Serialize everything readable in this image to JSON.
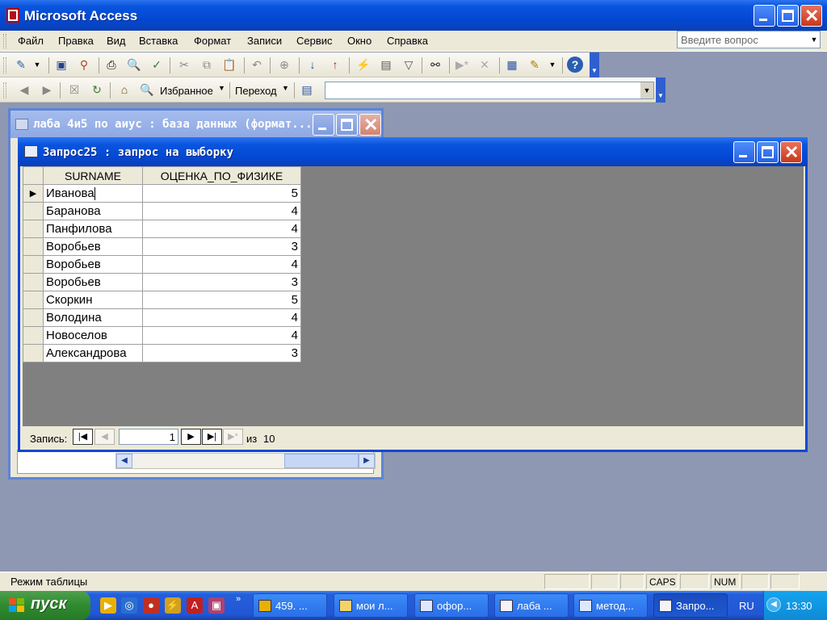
{
  "app": {
    "title": "Microsoft Access"
  },
  "menu": {
    "items": [
      "Файл",
      "Правка",
      "Вид",
      "Вставка",
      "Формат",
      "Записи",
      "Сервис",
      "Окно",
      "Справка"
    ],
    "help_placeholder": "Введите вопрос"
  },
  "web_toolbar": {
    "favorites": "Избранное",
    "go": "Переход"
  },
  "db_window": {
    "title": "лаба 4и5 по аиус : база данных (формат..."
  },
  "query_window": {
    "title": "Запрос25 : запрос на выборку",
    "columns": [
      "SURNAME",
      "ОЦЕНКА_ПО_ФИЗИКЕ"
    ],
    "rows": [
      {
        "surname": "Иванова",
        "grade": "5"
      },
      {
        "surname": "Баранова",
        "grade": "4"
      },
      {
        "surname": "Панфилова",
        "grade": "4"
      },
      {
        "surname": "Воробьев",
        "grade": "3"
      },
      {
        "surname": "Воробьев",
        "grade": "4"
      },
      {
        "surname": "Воробьев",
        "grade": "3"
      },
      {
        "surname": "Скоркин",
        "grade": "5"
      },
      {
        "surname": "Володина",
        "grade": "4"
      },
      {
        "surname": "Новоселов",
        "grade": "4"
      },
      {
        "surname": "Александрова",
        "grade": "3"
      }
    ],
    "nav": {
      "label": "Запись:",
      "current": "1",
      "of": "из",
      "total": "10"
    }
  },
  "statusbar": {
    "text": "Режим таблицы",
    "caps": "CAPS",
    "num": "NUM"
  },
  "taskbar": {
    "start": "пуск",
    "tasks": [
      "459. ...",
      "мои л...",
      "офор...",
      "лаба ...",
      "метод...",
      "Запро..."
    ],
    "lang": "RU",
    "clock": "13:30"
  },
  "colors": {
    "titlebar": "#0a55de",
    "taskbar": "#245edb",
    "start": "#2f8a2f",
    "workspace": "#8e98b2",
    "grid_bg": "#808080"
  }
}
